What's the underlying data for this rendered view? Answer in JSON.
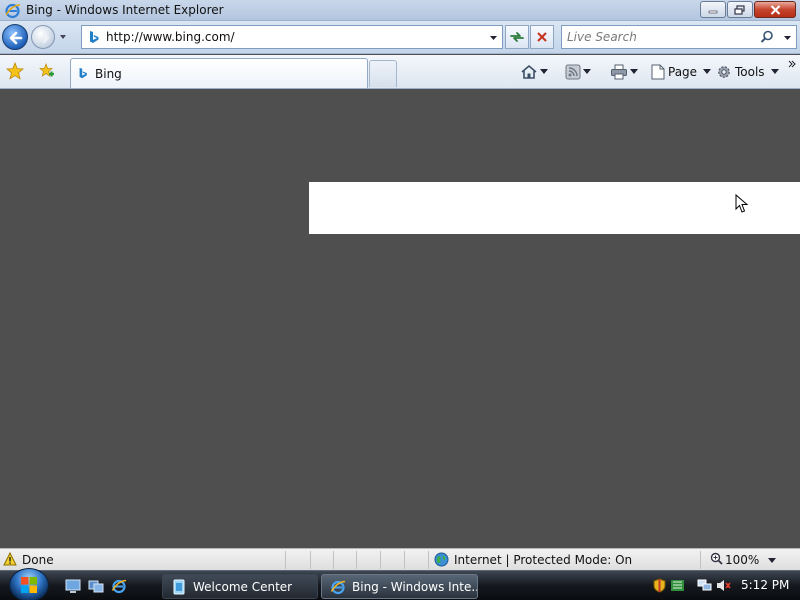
{
  "window": {
    "title": "Bing - Windows Internet Explorer",
    "icon": "ie-icon"
  },
  "navbar": {
    "address_url": "http://www.bing.com/",
    "search_placeholder": "Live Search"
  },
  "tabs": [
    {
      "label": "Bing",
      "active": true
    }
  ],
  "commands": {
    "page_label": "Page",
    "tools_label": "Tools"
  },
  "statusbar": {
    "status_text": "Done",
    "zone_text": "Internet | Protected Mode: On",
    "zoom_text": "100%"
  },
  "taskbar": {
    "buttons": [
      {
        "label": "Welcome Center",
        "active": false
      },
      {
        "label": "Bing - Windows Inte...",
        "active": true
      }
    ],
    "clock": "5:12 PM"
  },
  "colors": {
    "content_background": "#4f4f4f",
    "content_box": "#ffffff",
    "accent_blue": "#1f5fb8"
  }
}
